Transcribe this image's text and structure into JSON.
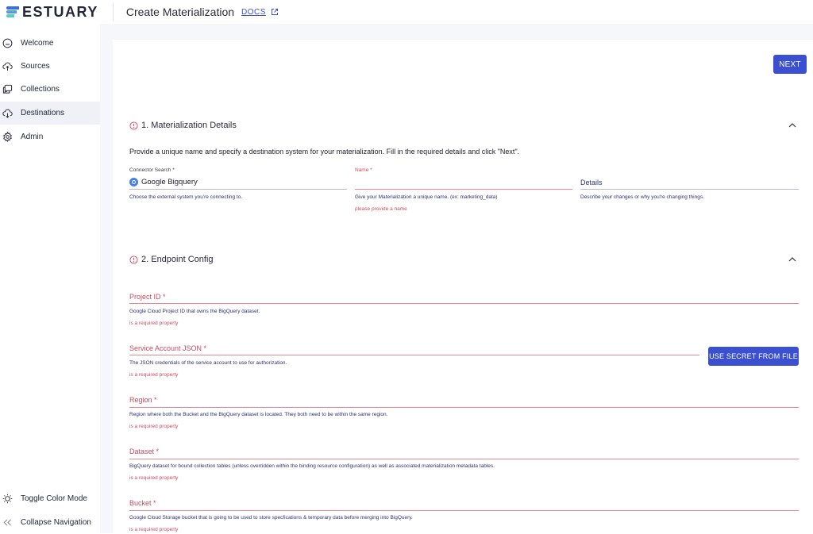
{
  "header": {
    "logo_text": "ESTUARY",
    "title": "Create Materialization",
    "docs_label": "DOCS"
  },
  "sidebar": {
    "items": [
      {
        "label": "Welcome",
        "icon": "home-icon",
        "active": false
      },
      {
        "label": "Sources",
        "icon": "cloud-upload-icon",
        "active": false
      },
      {
        "label": "Collections",
        "icon": "collections-icon",
        "active": false
      },
      {
        "label": "Destinations",
        "icon": "cloud-download-icon",
        "active": true
      },
      {
        "label": "Admin",
        "icon": "gear-icon",
        "active": false
      }
    ],
    "footer": [
      {
        "label": "Toggle Color Mode",
        "icon": "sun-icon"
      },
      {
        "label": "Collapse Navigation",
        "icon": "double-chevron-left-icon"
      }
    ]
  },
  "toolbar": {
    "next_label": "NEXT"
  },
  "section1": {
    "title": "1. Materialization Details",
    "intro": "Provide a unique name and specify a destination system for your materialization. Fill in the required details and click \"Next\".",
    "connector": {
      "label": "Connector Search *",
      "value": "Google Bigquery",
      "helper": "Choose the external system you're connecting to."
    },
    "name": {
      "label": "Name *",
      "value": "",
      "helper": "Give your Materialization a unique name. (ex: marketing_data)",
      "error": "please provide a name"
    },
    "details": {
      "placeholder": "Details",
      "helper": "Describe your changes or why you're changing things."
    }
  },
  "section2": {
    "title": "2. Endpoint Config",
    "use_secret_label": "USE SECRET FROM FILE",
    "fields": [
      {
        "label": "Project ID *",
        "helper": "Google Cloud Project ID that owns the BigQuery dataset.",
        "error": "is a required property"
      },
      {
        "label": "Service Account JSON *",
        "helper": "The JSON credentials of the service account to use for authorization.",
        "error": "is a required property"
      },
      {
        "label": "Region *",
        "helper": "Region where both the Bucket and the BigQuery dataset is located. They both need to be within the same region.",
        "error": "is a required property"
      },
      {
        "label": "Dataset *",
        "helper": "BigQuery dataset for bound collection tables (unless overridden within the binding resource configuration) as well as associated materialization metadata tables.",
        "error": "is a required property"
      },
      {
        "label": "Bucket *",
        "helper": "Google Cloud Storage bucket that is going to be used to store specfications & temporary data before merging into BigQuery.",
        "error": "is a required property"
      }
    ]
  },
  "colors": {
    "primary": "#3b4fd1",
    "error": "#d24a60",
    "helper_text": "#2d3272",
    "main_background": "#f6f7fb"
  }
}
